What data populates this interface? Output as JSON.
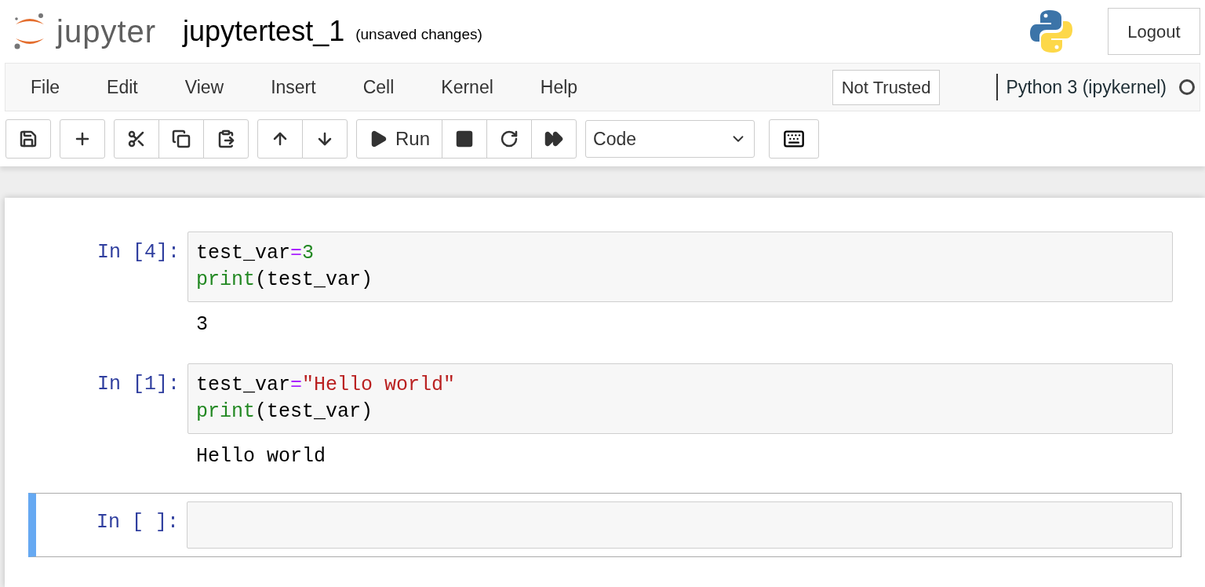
{
  "header": {
    "logo_text": "jupyter",
    "notebook_name": "jupytertest_1",
    "save_status": "(unsaved changes)",
    "logout": "Logout"
  },
  "menubar": {
    "items": [
      "File",
      "Edit",
      "View",
      "Insert",
      "Cell",
      "Kernel",
      "Help"
    ],
    "trust": "Not Trusted",
    "kernel": "Python 3 (ipykernel)",
    "kernel_busy": false
  },
  "toolbar": {
    "run_label": "Run",
    "cell_type": "Code"
  },
  "cells": [
    {
      "prompt": "In [4]:",
      "selected": false,
      "lines": [
        [
          {
            "kind": "plain",
            "text": "test_var"
          },
          {
            "kind": "op",
            "text": "="
          },
          {
            "kind": "number",
            "text": "3"
          }
        ],
        [
          {
            "kind": "builtin",
            "text": "print"
          },
          {
            "kind": "plain",
            "text": "(test_var)"
          }
        ]
      ],
      "output": "3"
    },
    {
      "prompt": "In [1]:",
      "selected": false,
      "lines": [
        [
          {
            "kind": "plain",
            "text": "test_var"
          },
          {
            "kind": "op",
            "text": "="
          },
          {
            "kind": "string",
            "text": "\"Hello world\""
          }
        ],
        [
          {
            "kind": "builtin",
            "text": "print"
          },
          {
            "kind": "plain",
            "text": "(test_var)"
          }
        ]
      ],
      "output": "Hello world"
    },
    {
      "prompt": "In [ ]:",
      "selected": true
    }
  ]
}
